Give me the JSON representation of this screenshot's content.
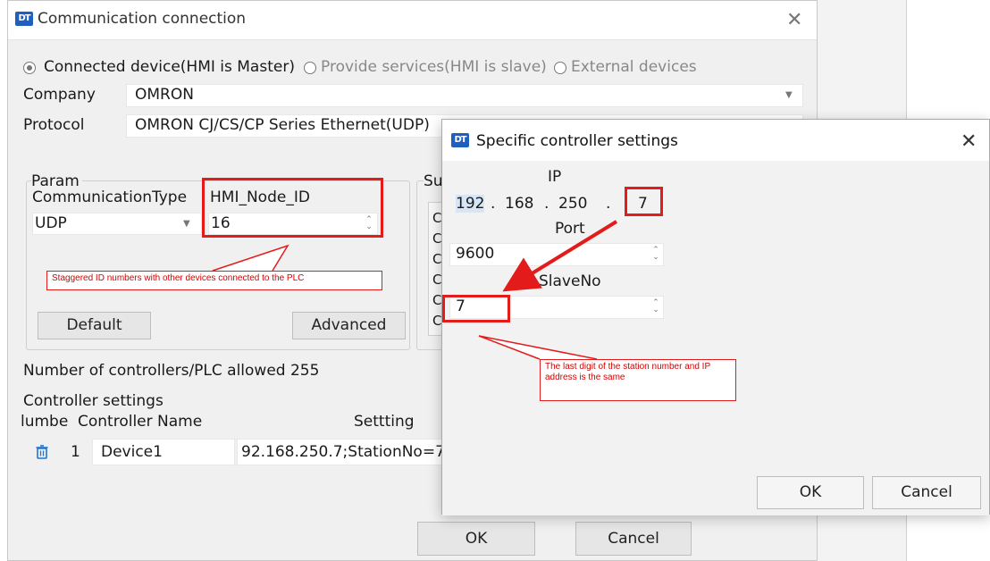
{
  "main_window": {
    "logo_text": "DT",
    "title": "Communication connection",
    "close_glyph": "✕",
    "mode": {
      "options": [
        "Connected device(HMI is Master)",
        "Provide services(HMI is slave)",
        "External devices"
      ],
      "selected_index": 0
    },
    "company": {
      "label": "Company",
      "value": "OMRON"
    },
    "protocol": {
      "label": "Protocol",
      "value": "OMRON CJ/CS/CP Series Ethernet(UDP)"
    },
    "param": {
      "group_label": "Param",
      "comm_type_label": "CommunicationType",
      "comm_type_value": "UDP",
      "node_id_label": "HMI_Node_ID",
      "node_id_value": "16",
      "default_button": "Default",
      "advanced_button": "Advanced"
    },
    "sub_group_label": "Su",
    "sub_group_items": [
      "C",
      "C",
      "C",
      "C",
      "C",
      "C"
    ],
    "plc_allowed": "Number of controllers/PLC allowed 255",
    "controller_settings_label": "Controller settings",
    "table": {
      "headers": [
        "lumbe",
        "Controller Name",
        "Settting"
      ],
      "rows": [
        {
          "number": "1",
          "name": "Device1",
          "setting": "92.168.250.7;StationNo=7"
        }
      ]
    },
    "ok_button": "OK",
    "cancel_button": "Cancel"
  },
  "dialog": {
    "logo_text": "DT",
    "title": "Specific controller settings",
    "close_glyph": "✕",
    "ip_label": "IP",
    "ip": [
      "192",
      "168",
      "250",
      "7"
    ],
    "port_label": "Port",
    "port_value": "9600",
    "slave_label": "SlaveNo",
    "slave_value": "7",
    "ok_button": "OK",
    "cancel_button": "Cancel"
  },
  "annotations": {
    "note_left": "Staggered ID numbers with other devices connected to the PLC",
    "note_right": "The last digit of the station number and IP address is the same",
    "accent_color": "#e41b1b"
  },
  "icons": {
    "delete_row": "trash-icon",
    "dropdown": "chevron-down-icon",
    "spinner": "spinner-arrows-icon"
  }
}
